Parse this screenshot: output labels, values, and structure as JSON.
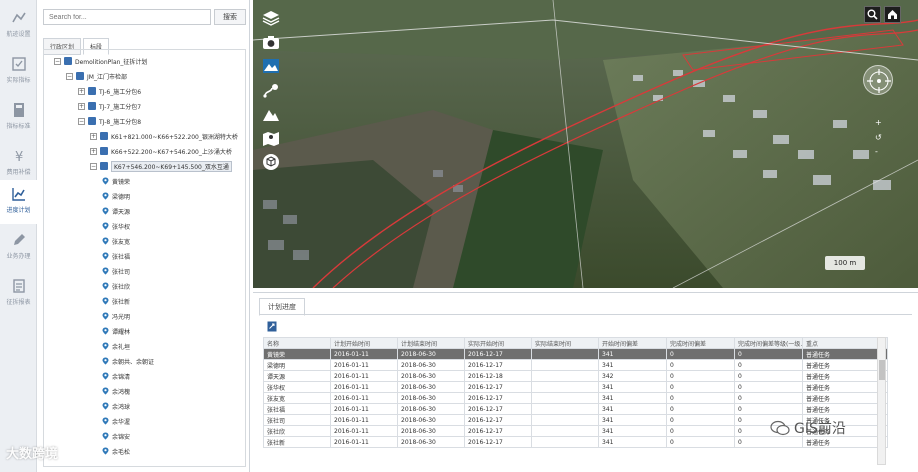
{
  "rail": [
    {
      "label": "航迹设置",
      "icon": "route-icon"
    },
    {
      "label": "实际指标",
      "icon": "checklist-icon"
    },
    {
      "label": "指标标准",
      "icon": "calculator-icon"
    },
    {
      "label": "费用补偿",
      "icon": "money-icon"
    },
    {
      "label": "进度计划",
      "icon": "chart-line-icon"
    },
    {
      "label": "业务办理",
      "icon": "edit-icon"
    },
    {
      "label": "征拆报表",
      "icon": "report-icon"
    }
  ],
  "search": {
    "placeholder": "Search for...",
    "button": "搜索"
  },
  "tabs": [
    "行政区划",
    "标段"
  ],
  "tree": {
    "root": "DemolitionPlan_征拆计划",
    "project": "JM_江门市检部",
    "sections": [
      "TJ-6_施工分包6",
      "TJ-7_施工分包7",
      "TJ-8_施工分包8"
    ],
    "segments": [
      "K61+821.000~K66+522.200_银洲湖特大桥",
      "K66+522.200~K67+546.200_上沙涌大桥",
      "K67+546.200~K69+145.500_双水互通"
    ],
    "people": [
      "黄镜荣",
      "梁德明",
      "谭天源",
      "张华权",
      "张友宽",
      "张社福",
      "张社司",
      "张社欣",
      "张社新",
      "冯光明",
      "谭耀林",
      "余礼垣",
      "余朝共、余朝证",
      "余锦清",
      "余鸿槐",
      "余鸿球",
      "余华渥",
      "余锦安",
      "余毛松"
    ]
  },
  "map": {
    "scale": "100 m",
    "zoom_in": "+",
    "zoom_out": "-",
    "reset": "↺"
  },
  "plan": {
    "tab": "计划进度",
    "columns": [
      "名称",
      "计划开始时间",
      "计划结束时间",
      "实际开始时间",
      "实际结束时间",
      "开始时间偏差",
      "完成时间偏差",
      "完成时间偏差等级(一级...)",
      "重点"
    ],
    "rows": [
      [
        "黄镜荣",
        "2016-01-11",
        "2018-06-30",
        "2016-12-17",
        "",
        "341",
        "0",
        "0",
        "普通任务"
      ],
      [
        "梁德明",
        "2016-01-11",
        "2018-06-30",
        "2016-12-17",
        "",
        "341",
        "0",
        "0",
        "普通任务"
      ],
      [
        "谭天源",
        "2016-01-11",
        "2018-06-30",
        "2016-12-18",
        "",
        "342",
        "0",
        "0",
        "普通任务"
      ],
      [
        "张华权",
        "2016-01-11",
        "2018-06-30",
        "2016-12-17",
        "",
        "341",
        "0",
        "0",
        "普通任务"
      ],
      [
        "张友宽",
        "2016-01-11",
        "2018-06-30",
        "2016-12-17",
        "",
        "341",
        "0",
        "0",
        "普通任务"
      ],
      [
        "张社福",
        "2016-01-11",
        "2018-06-30",
        "2016-12-17",
        "",
        "341",
        "0",
        "0",
        "普通任务"
      ],
      [
        "张社司",
        "2016-01-11",
        "2018-06-30",
        "2016-12-17",
        "",
        "341",
        "0",
        "0",
        "普通任务"
      ],
      [
        "张社欣",
        "2016-01-11",
        "2018-06-30",
        "2016-12-17",
        "",
        "341",
        "0",
        "0",
        "普通任务"
      ],
      [
        "张社新",
        "2016-01-11",
        "2018-06-30",
        "2016-12-17",
        "",
        "341",
        "0",
        "0",
        "普通任务"
      ]
    ]
  },
  "watermark": {
    "left": "大数跨境",
    "right": "GIS前沿"
  }
}
